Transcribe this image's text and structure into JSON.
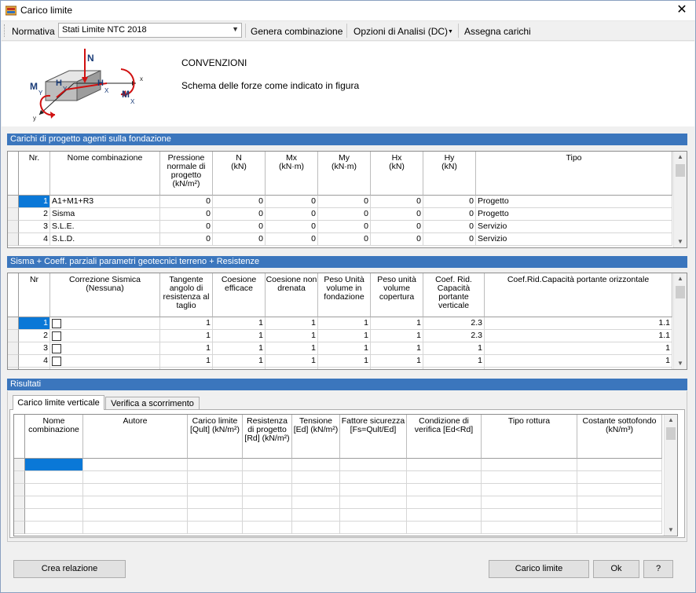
{
  "window": {
    "title": "Carico limite"
  },
  "toolbar": {
    "normativa_label": "Normativa",
    "normativa_value": "Stati Limite NTC 2018",
    "genera_label": "Genera combinazione",
    "opzioni_label": "Opzioni di Analisi (DC)",
    "assegna_label": "Assegna carichi"
  },
  "conventions": {
    "heading": "CONVENZIONI",
    "text": "Schema delle forze come indicato in figura",
    "diagram_labels": {
      "n": "N",
      "mx": "M",
      "mx_sub": "X",
      "my": "M",
      "my_sub": "Y",
      "hx": "H",
      "hx_sub": "X",
      "hy": "H",
      "hy_sub": "Y",
      "x": "x",
      "y": "y"
    }
  },
  "carichi": {
    "title": "Carichi di progetto agenti sulla fondazione",
    "headers": [
      "Nr.",
      "Nome combinazione",
      "Pressione normale di progetto (kN/m²)",
      "N\n(kN)",
      "Mx\n(kN·m)",
      "My\n(kN·m)",
      "Hx\n(kN)",
      "Hy\n(kN)",
      "Tipo"
    ],
    "rows": [
      [
        "1",
        "A1+M1+R3",
        "0",
        "0",
        "0",
        "0",
        "0",
        "0",
        "Progetto"
      ],
      [
        "2",
        "Sisma",
        "0",
        "0",
        "0",
        "0",
        "0",
        "0",
        "Progetto"
      ],
      [
        "3",
        "S.L.E.",
        "0",
        "0",
        "0",
        "0",
        "0",
        "0",
        "Servizio"
      ],
      [
        "4",
        "S.L.D.",
        "0",
        "0",
        "0",
        "0",
        "0",
        "0",
        "Servizio"
      ]
    ]
  },
  "sisma": {
    "title": "Sisma + Coeff. parziali parametri geotecnici terreno + Resistenze",
    "headers": [
      "Nr",
      "Correzione Sismica\n(Nessuna)",
      "Tangente angolo di resistenza al taglio",
      "Coesione efficace",
      "Coesione non drenata",
      "Peso Unità volume in fondazione",
      "Peso unità volume copertura",
      "Coef. Rid. Capacità portante verticale",
      "Coef.Rid.Capacità portante orizzontale"
    ],
    "rows": [
      [
        "1",
        "",
        "1",
        "1",
        "1",
        "1",
        "1",
        "2.3",
        "1.1"
      ],
      [
        "2",
        "",
        "1",
        "1",
        "1",
        "1",
        "1",
        "2.3",
        "1.1"
      ],
      [
        "3",
        "",
        "1",
        "1",
        "1",
        "1",
        "1",
        "1",
        "1"
      ],
      [
        "4",
        "",
        "1",
        "1",
        "1",
        "1",
        "1",
        "1",
        "1"
      ]
    ]
  },
  "risultati": {
    "title": "Risultati",
    "tabs": [
      "Carico limite verticale",
      "Verifica a scorrimento"
    ],
    "headers": [
      "Nome combinazione",
      "Autore",
      "Carico limite [Qult] (kN/m²)",
      "Resistenza di progetto [Rd] (kN/m²)",
      "Tensione [Ed] (kN/m²)",
      "Fattore sicurezza [Fs=Qult/Ed]",
      "Condizione di verifica [Ed<Rd]",
      "Tipo rottura",
      "Costante sottofondo (kN/m³)"
    ]
  },
  "buttons": {
    "crea": "Crea relazione",
    "carico": "Carico limite",
    "ok": "Ok",
    "help": "?"
  }
}
